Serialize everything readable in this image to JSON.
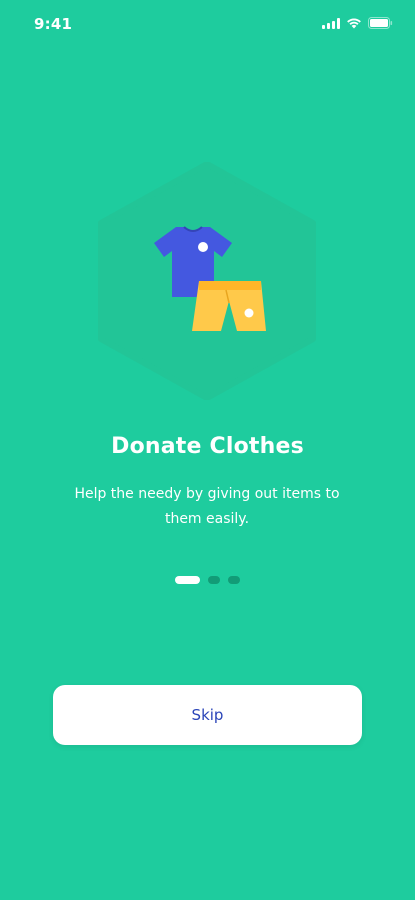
{
  "status_bar": {
    "time": "9:41",
    "icons": [
      "signal-icon",
      "wifi-icon",
      "battery-icon"
    ]
  },
  "onboarding": {
    "illustration": [
      "tshirt-icon",
      "shorts-icon"
    ],
    "title": "Donate Clothes",
    "description": "Help the needy by giving out items to them easily.",
    "page_indicator": {
      "current": 1,
      "total": 3
    }
  },
  "actions": {
    "skip_label": "Skip"
  },
  "colors": {
    "background": "#1ECC9E",
    "hexagon": "#22C597",
    "tshirt": "#4458E0",
    "shorts": "#FFC94A",
    "dot_inactive": "#129C77",
    "skip_text": "#2A44B8"
  }
}
